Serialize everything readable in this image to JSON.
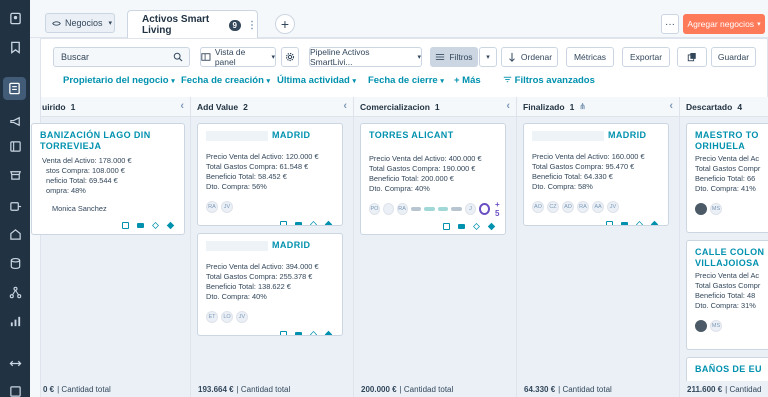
{
  "nav": {
    "icons": [
      "contacts-icon",
      "bookmark-icon",
      "deals-icon",
      "megaphone-icon",
      "content-icon",
      "commerce-icon",
      "service-icon",
      "automation-icon",
      "database-icon",
      "workflows-icon",
      "reports-icon",
      "expand-icon",
      "menu-icon"
    ]
  },
  "header": {
    "view_switch_label": "Negocios",
    "tab_label": "Activos Smart Living",
    "tab_badge": "9",
    "tab_more": "⋮",
    "add_tab": "+",
    "more_label": "···",
    "add_deal_label": "Agregar negocios"
  },
  "toolbar": {
    "search_placeholder": "Buscar",
    "view_panel_label": "Vista de panel",
    "pipeline_label": "Pipeline Activos SmartLivi...",
    "filters_label": "Filtros",
    "sort_label": "Ordenar",
    "metrics_label": "Métricas",
    "export_label": "Exportar",
    "save_label": "Guardar"
  },
  "filters": {
    "owner": "Propietario del negocio",
    "created": "Fecha de creación",
    "last_activity": "Última actividad",
    "close_date": "Fecha de cierre",
    "more": "+ Más",
    "advanced": "Filtros avanzados"
  },
  "columns": [
    {
      "name": "uirido",
      "count": "1",
      "total": "0 €",
      "total_label": "| Cantidad total",
      "cards": [
        {
          "title": "BANIZACIÓN LAGO DIN TORREVIEJA",
          "lines": [
            "Venta del Activo: 178.000 €",
            "stos Compra: 108.000 €",
            "neficio Total: 69.544 €",
            "ompra: 48%"
          ],
          "owner": "Monica Sanchez"
        }
      ]
    },
    {
      "name": "Add Value",
      "count": "2",
      "total": "193.664 €",
      "total_label": "| Cantidad total",
      "cards": [
        {
          "title": "MADRID",
          "lines": [
            "Precio Venta del Activo: 120.000 €",
            "Total Gastos Compra: 61.548 €",
            "Beneficio Total: 58.452 €",
            "Dto. Compra: 56%"
          ],
          "avatars": [
            "RA",
            "JV"
          ]
        },
        {
          "title": "MADRID",
          "lines": [
            "Precio Venta del Activo: 394.000 €",
            "Total Gastos Compra: 255.378 €",
            "Beneficio Total: 138.622 €",
            "Dto. Compra: 40%"
          ],
          "avatars": [
            "ET",
            "LO",
            "JV"
          ]
        }
      ]
    },
    {
      "name": "Comercializacion",
      "count": "1",
      "total": "200.000 €",
      "total_label": "| Cantidad total",
      "cards": [
        {
          "title": "TORRES ALICANT",
          "lines": [
            "Precio Venta del Activo: 400.000 €",
            "Total Gastos Compra: 190.000 €",
            "Beneficio Total: 200.000 €",
            "Dto. Compra: 40%"
          ],
          "avatars": [
            "PO",
            "RA",
            "J"
          ],
          "more": "+ 5"
        }
      ]
    },
    {
      "name": "Finalizado",
      "count": "1",
      "total": "64.330 €",
      "total_label": "| Cantidad total",
      "cards": [
        {
          "title": "MADRID",
          "lines": [
            "Precio Venta del Activo: 160.000 €",
            "Total Gastos Compra: 95.470 €",
            "Beneficio Total: 64.330 €",
            "Dto. Compra: 58%"
          ],
          "avatars": [
            "AO",
            "CZ",
            "AD",
            "RA",
            "AA",
            "JV"
          ]
        }
      ]
    },
    {
      "name": "Descartado",
      "count": "4",
      "total": "211.600 €",
      "total_label": "| Cantidad",
      "cards": [
        {
          "title": "MAESTRO TO ORIHUELA",
          "lines": [
            "Precio Venta del Ac",
            "Total Gastos Compr",
            "Beneficio Total: 66",
            "Dto. Compra: 41%"
          ],
          "avatars": [
            "MS"
          ]
        },
        {
          "title": "CALLE COLON VILLAJOIOSA",
          "lines": [
            "Precio Venta del Ac",
            "Total Gastos Compr",
            "Beneficio Total: 48",
            "Dto. Compra: 31%"
          ],
          "avatars": [
            "MS"
          ]
        },
        {
          "title": "BAÑOS DE EU",
          "lines": []
        }
      ]
    }
  ]
}
